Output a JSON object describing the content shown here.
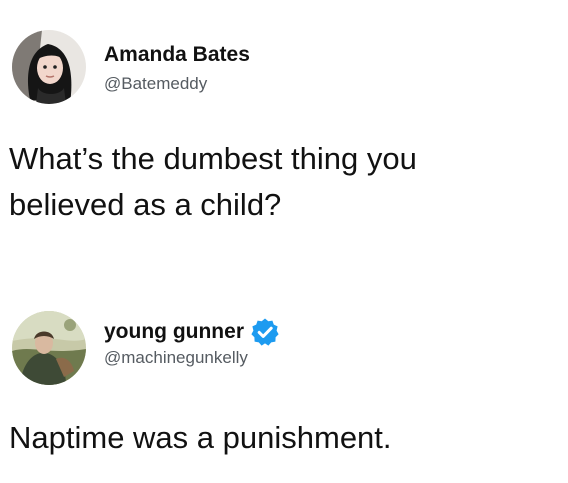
{
  "tweets": [
    {
      "author": {
        "name": "Amanda Bates",
        "handle": "@Batemeddy",
        "verified": false,
        "avatar_icon": "woman-portrait-avatar"
      },
      "text_lines": [
        "What’s the dumbest thing you",
        "believed as a child?"
      ]
    },
    {
      "author": {
        "name": "young gunner",
        "handle": "@machinegunkelly",
        "verified": true,
        "verified_icon": "verified-badge-icon",
        "avatar_icon": "man-outdoor-avatar"
      },
      "text_lines": [
        "Naptime was a punishment."
      ]
    }
  ],
  "colors": {
    "text": "#111111",
    "handle": "#555b61",
    "verified_blue": "#1d9bf0",
    "background": "#ffffff"
  }
}
